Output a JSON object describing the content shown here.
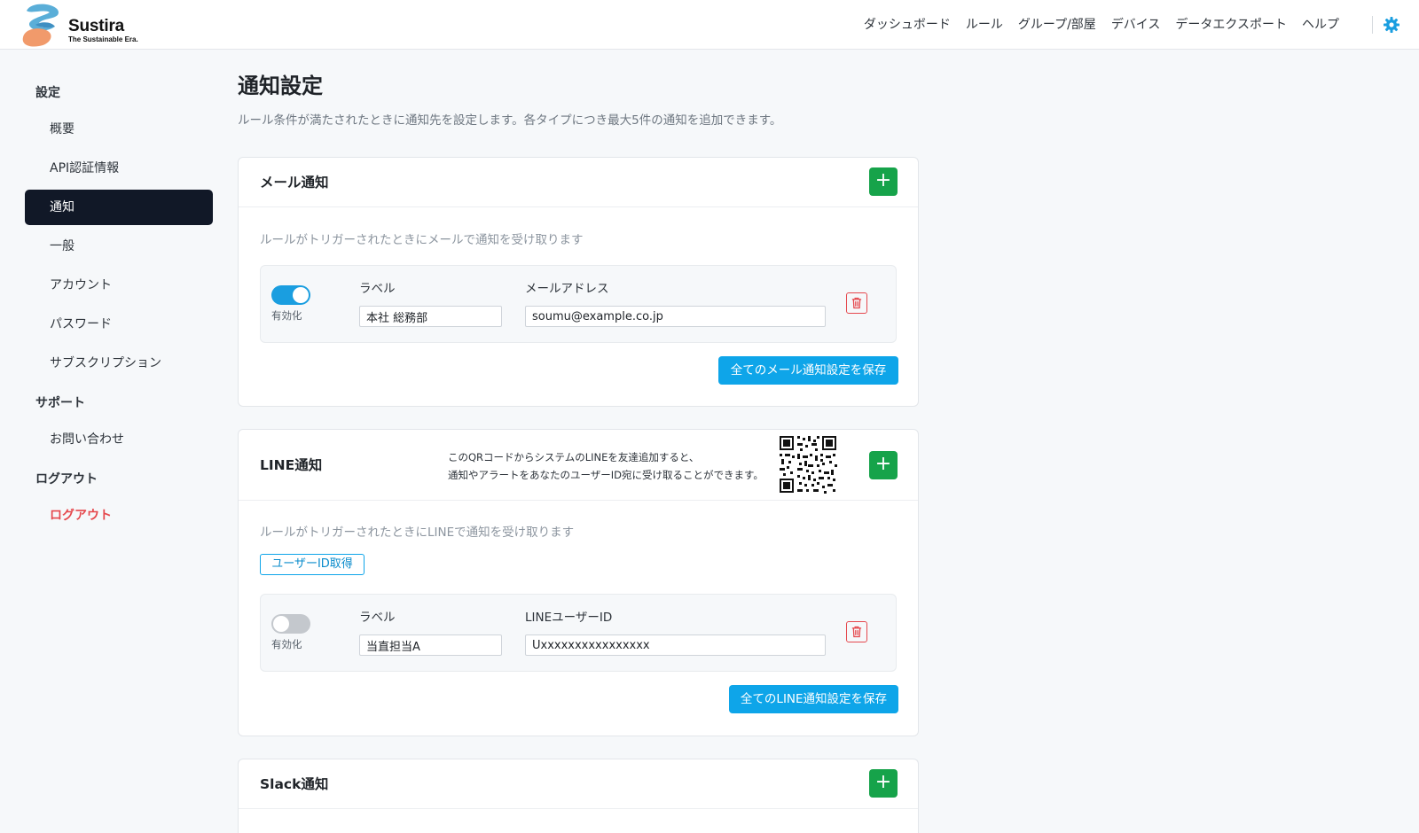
{
  "header": {
    "logo_name": "Sustira",
    "logo_tagline": "The Sustainable Era.",
    "nav": [
      "ダッシュボード",
      "ルール",
      "グループ/部屋",
      "デバイス",
      "データエクスポート",
      "ヘルプ"
    ],
    "settings_icon": "gear-icon",
    "accent_color": "#1a9ee0"
  },
  "sidebar": {
    "settings_heading": "設定",
    "settings_items": [
      "概要",
      "API認証情報",
      "通知",
      "一般",
      "アカウント",
      "パスワード",
      "サブスクリプション"
    ],
    "active_item": "通知",
    "support_heading": "サポート",
    "support_items": [
      "お問い合わせ"
    ],
    "logout_heading": "ログアウト",
    "logout_item": "ログアウト"
  },
  "page": {
    "title": "通知設定",
    "description": "ルール条件が満たされたときに通知先を設定します。各タイプにつき最大5件の通知を追加できます。"
  },
  "email": {
    "title": "メール通知",
    "add_label": "+",
    "note": "ルールがトリガーされたときにメールで通知を受け取ります",
    "row": {
      "enabled": true,
      "enabled_label": "有効化",
      "label_heading": "ラベル",
      "label_value": "本社 総務部",
      "address_heading": "メールアドレス",
      "address_value": "soumu@example.co.jp"
    },
    "save_label": "全てのメール通知設定を保存"
  },
  "line": {
    "title": "LINE通知",
    "add_label": "+",
    "qr_note_1": "このQRコードからシステムのLINEを友達追加すると、",
    "qr_note_2": "通知やアラートをあなたのユーザーID宛に受け取ることができます。",
    "note": "ルールがトリガーされたときにLINEで通知を受け取ります",
    "userid_button": "ユーザーID取得",
    "row": {
      "enabled": false,
      "enabled_label": "有効化",
      "label_heading": "ラベル",
      "label_value": "当直担当A",
      "id_heading": "LINEユーザーID",
      "id_value": "Uxxxxxxxxxxxxxxxx"
    },
    "save_label": "全てのLINE通知設定を保存"
  },
  "slack": {
    "title": "Slack通知",
    "add_label": "+"
  }
}
